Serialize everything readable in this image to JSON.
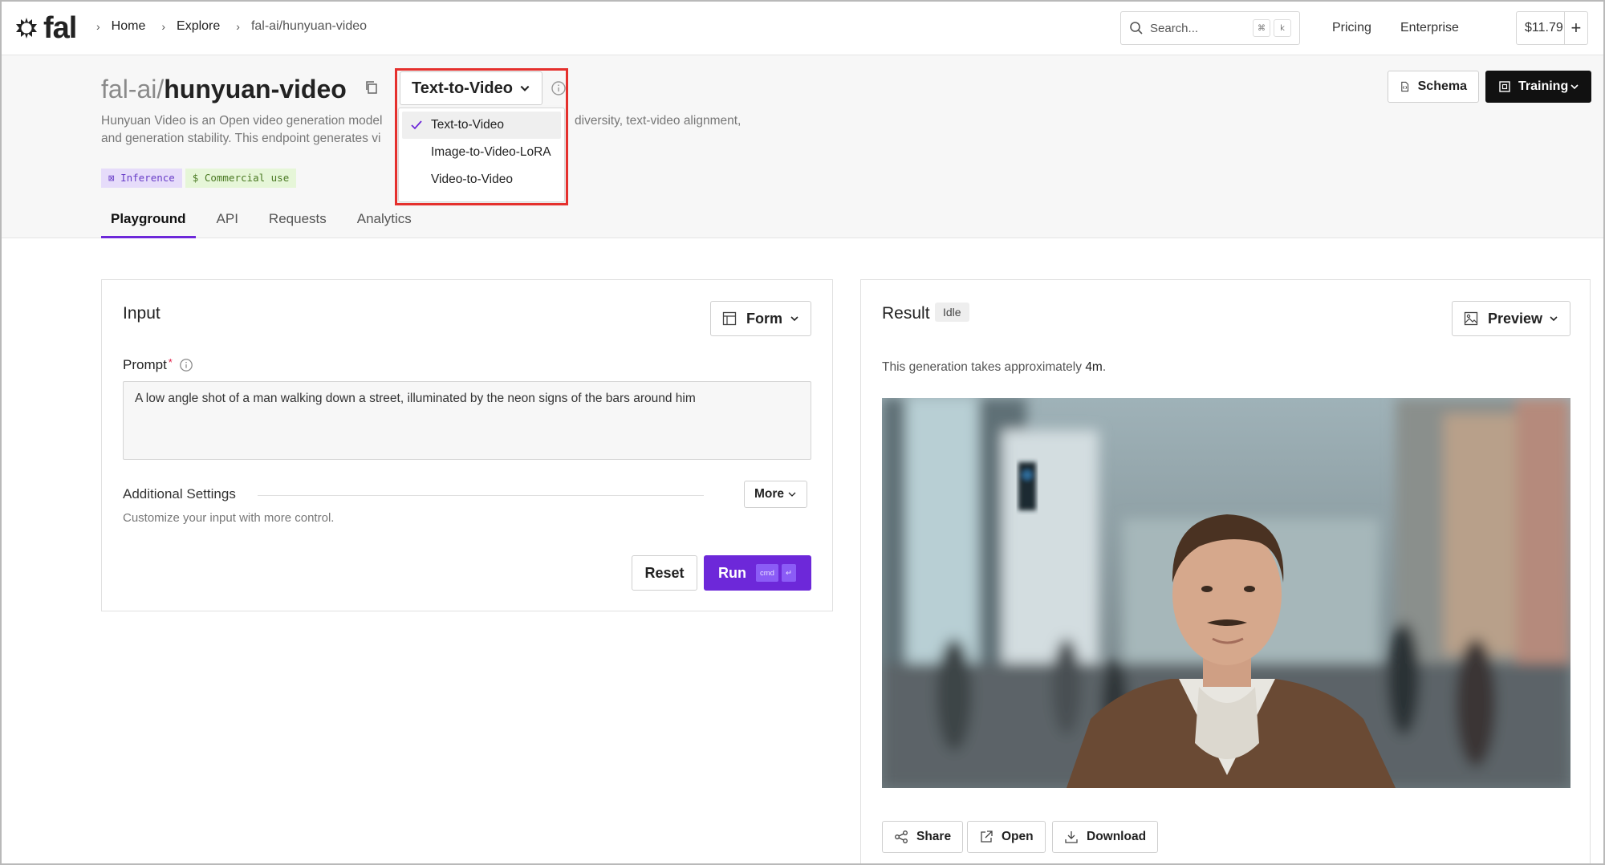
{
  "nav": {
    "logo": "fal",
    "breadcrumbs": [
      "Home",
      "Explore",
      "fal-ai/hunyuan-video"
    ],
    "search_placeholder": "Search...",
    "search_kbd": [
      "⌘",
      "k"
    ],
    "links": [
      "Pricing",
      "Enterprise"
    ],
    "credits": "$11.79",
    "add_label": "+"
  },
  "header": {
    "owner": "fal-ai/",
    "model": "hunyuan-video",
    "endpoint_selected": "Text-to-Video",
    "endpoint_options": [
      "Text-to-Video",
      "Image-to-Video-LoRA",
      "Video-to-Video"
    ],
    "description_line1_left": "Hunyuan Video is an Open video generation model",
    "description_line1_right": "diversity, text-video alignment,",
    "description_line2": "and generation stability. This endpoint generates vi",
    "badges": [
      "Inference",
      "Commercial use"
    ],
    "schema_label": "Schema",
    "training_label": "Training",
    "tabs": [
      "Playground",
      "API",
      "Requests",
      "Analytics"
    ],
    "active_tab": "Playground"
  },
  "input": {
    "title": "Input",
    "mode_label": "Form",
    "prompt_label": "Prompt",
    "prompt_required": "*",
    "prompt_value": "A low angle shot of a man walking down a street, illuminated by the neon signs of the bars around him",
    "additional_title": "Additional Settings",
    "additional_sub": "Customize your input with more control.",
    "more_label": "More",
    "reset_label": "Reset",
    "run_label": "Run",
    "run_kbd": [
      "cmd",
      "↵"
    ]
  },
  "result": {
    "title": "Result",
    "status": "Idle",
    "preview_label": "Preview",
    "approx_prefix": "This generation takes approximately",
    "approx_value": "4m",
    "approx_suffix": ".",
    "actions": [
      "Share",
      "Open",
      "Download"
    ]
  },
  "colors": {
    "accent": "#6d28d9",
    "highlight": "#e5302d",
    "inference_badge_bg": "#e6dcfa",
    "commercial_badge_bg": "#e6f6d8"
  }
}
